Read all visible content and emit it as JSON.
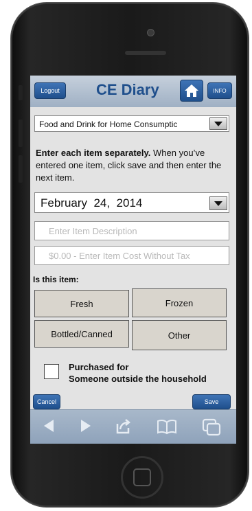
{
  "header": {
    "logout_label": "Logout",
    "title": "CE Diary",
    "info_label": "INFO",
    "home_icon": "home-icon"
  },
  "category_select": {
    "value": "Food and Drink for Home Consumptic"
  },
  "instructions": {
    "bold": "Enter each item separately.",
    "rest": " When you’ve entered one item, click save and then enter the next item."
  },
  "date_select": {
    "value": "February  24,  2014"
  },
  "item_description": {
    "placeholder": "Enter Item Description"
  },
  "item_cost": {
    "placeholder": "$0.00 - Enter Item Cost Without Tax"
  },
  "item_type": {
    "question": "Is this item:",
    "options": [
      "Fresh",
      "Frozen",
      "Bottled/Canned",
      "Other"
    ]
  },
  "purchased_for": {
    "line1": "Purchased for",
    "line2": "Someone outside the household"
  },
  "actions": {
    "cancel_label": "Cancel",
    "save_label": "Save"
  },
  "browser_toolbar": {
    "icons": [
      "back-icon",
      "forward-icon",
      "share-icon",
      "bookmarks-icon",
      "tabs-icon"
    ]
  },
  "colors": {
    "brand_blue": "#1f4f8c",
    "titlebar": "#b8c5d3",
    "toolbar": "#9aacc2",
    "choice_bg": "#d9d5cd"
  }
}
